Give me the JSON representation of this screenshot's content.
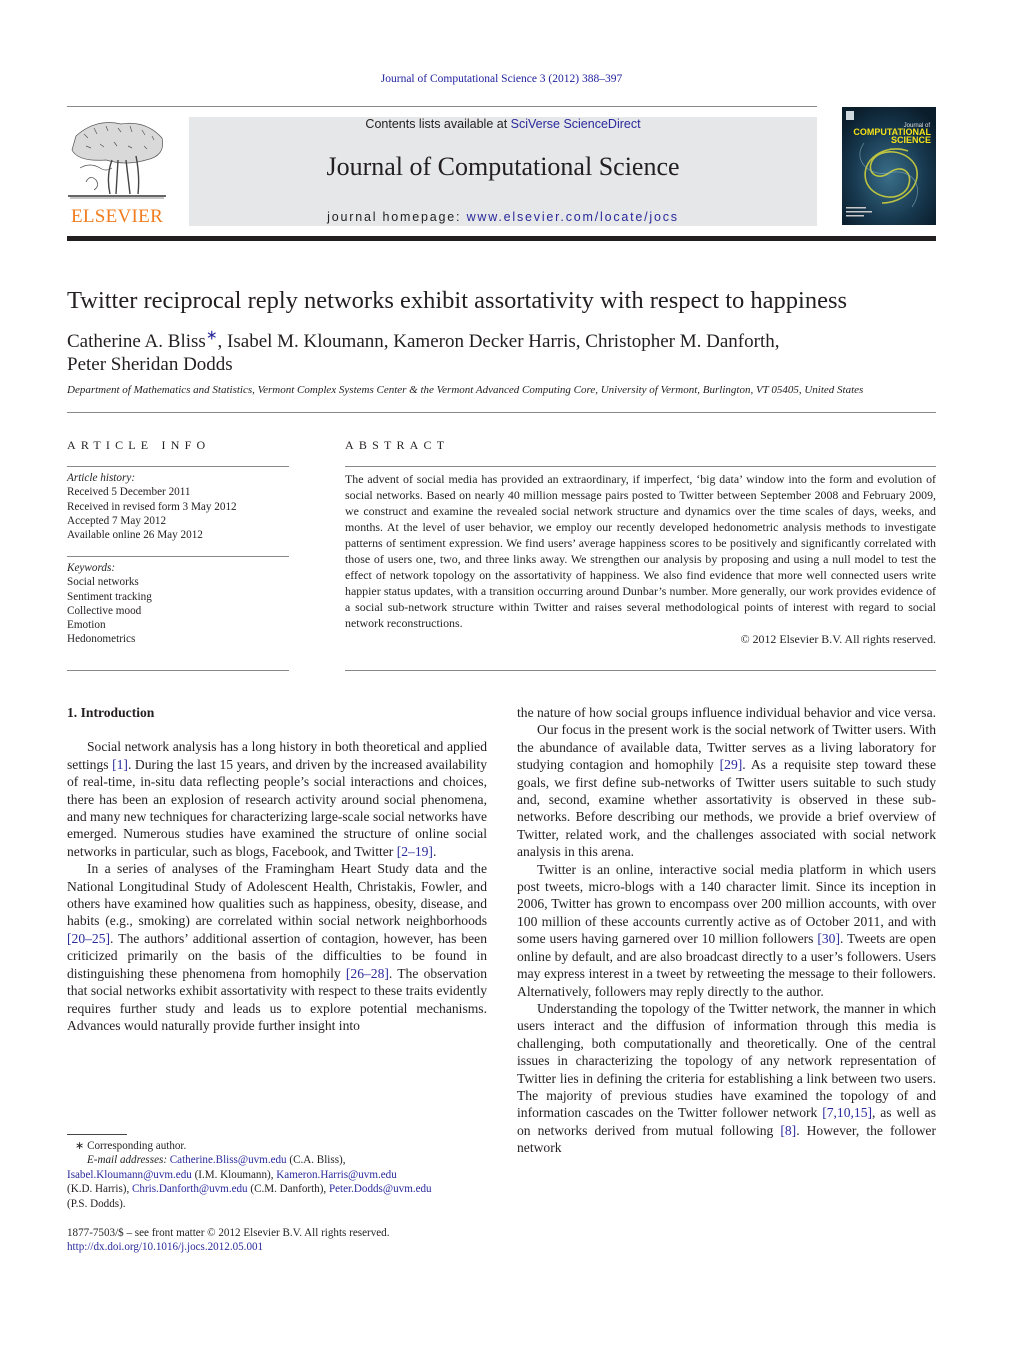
{
  "running_head": "Journal of Computational Science 3 (2012) 388–397",
  "masthead": {
    "contents_prefix": "Contents lists available at ",
    "contents_link": "SciVerse ScienceDirect",
    "journal_title": "Journal of Computational Science",
    "homepage_prefix": "journal homepage: ",
    "homepage_link": "www.elsevier.com/locate/jocs",
    "publisher_logo_text": "ELSEVIER",
    "cover_title_small": "Journal of",
    "cover_title_line1": "COMPUTATIONAL",
    "cover_title_line2": "SCIENCE",
    "colors": {
      "masthead_bg": "#e6e7e8",
      "elsevier_orange": "#f07c1f",
      "link_blue": "#2a2a9c",
      "cover_yellow": "#f4e21a"
    }
  },
  "article": {
    "title": "Twitter reciprocal reply networks exhibit assortativity with respect to happiness",
    "authors_line1_a": "Catherine A. Bliss",
    "author_marker": "∗",
    "authors_line1_b": ", Isabel M. Kloumann, Kameron Decker Harris, Christopher M. Danforth,",
    "authors_line2": "Peter Sheridan Dodds",
    "affiliation": "Department of Mathematics and Statistics, Vermont Complex Systems Center & the Vermont Advanced Computing Core, University of Vermont, Burlington, VT 05405, United States"
  },
  "article_info": {
    "heading": "ARTICLE INFO",
    "history_label": "Article history:",
    "history": [
      "Received 5 December 2011",
      "Received in revised form 3 May 2012",
      "Accepted 7 May 2012",
      "Available online 26 May 2012"
    ],
    "keywords_label": "Keywords:",
    "keywords": [
      "Social networks",
      "Sentiment tracking",
      "Collective mood",
      "Emotion",
      "Hedonometrics"
    ]
  },
  "abstract": {
    "heading": "ABSTRACT",
    "text": "The advent of social media has provided an extraordinary, if imperfect, ‘big data’ window into the form and evolution of social networks. Based on nearly 40 million message pairs posted to Twitter between September 2008 and February 2009, we construct and examine the revealed social network structure and dynamics over the time scales of days, weeks, and months. At the level of user behavior, we employ our recently developed hedonometric analysis methods to investigate patterns of sentiment expression. We find users’ average happiness scores to be positively and significantly correlated with those of users one, two, and three links away. We strengthen our analysis by proposing and using a null model to test the effect of network topology on the assortativity of happiness. We also find evidence that more well connected users write happier status updates, with a transition occurring around Dunbar’s number. More generally, our work provides evidence of a social sub-network structure within Twitter and raises several methodological points of interest with regard to social network reconstructions.",
    "copyright": "© 2012 Elsevier B.V. All rights reserved."
  },
  "body": {
    "section_heading": "1.  Introduction",
    "left": {
      "p1_a": "Social network analysis has a long history in both theoretical and applied settings ",
      "p1_ref1": "[1]",
      "p1_b": ". During the last 15 years, and driven by the increased availability of real-time, in-situ data reflecting people’s social interactions and choices, there has been an explosion of research activity around social phenomena, and many new techniques for characterizing large-scale social networks have emerged. Numerous studies have examined the structure of online social networks in particular, such as blogs, Facebook, and Twitter ",
      "p1_ref2": "[2–19]",
      "p1_c": ".",
      "p2_a": "In a series of analyses of the Framingham Heart Study data and the National Longitudinal Study of Adolescent Health, Christakis, Fowler, and others have examined how qualities such as happiness, obesity, disease, and habits (e.g., smoking) are correlated within social network neighborhoods ",
      "p2_ref1": "[20–25]",
      "p2_b": ". The authors’ additional assertion of contagion, however, has been criticized primarily on the basis of the difficulties to be found in distinguishing these phenomena from homophily ",
      "p2_ref2": "[26–28]",
      "p2_c": ". The observation that social networks exhibit assortativity with respect to these traits evidently requires further study and leads us to explore potential mechanisms. Advances would naturally provide further insight into"
    },
    "right": {
      "p0": "the nature of how social groups influence individual behavior and vice versa.",
      "p1_a": "Our focus in the present work is the social network of Twitter users. With the abundance of available data, Twitter serves as a living laboratory for studying contagion and homophily ",
      "p1_ref": "[29]",
      "p1_b": ". As a requisite step toward these goals, we first define sub-networks of Twitter users suitable to such study and, second, examine whether assortativity is observed in these sub-networks. Before describing our methods, we provide a brief overview of Twitter, related work, and the challenges associated with social network analysis in this arena.",
      "p2_a": "Twitter is an online, interactive social media platform in which users post tweets, micro-blogs with a 140 character limit. Since its inception in 2006, Twitter has grown to encompass over 200 million accounts, with over 100 million of these accounts currently active as of October 2011, and with some users having garnered over 10 million followers ",
      "p2_ref": "[30]",
      "p2_b": ". Tweets are open online by default, and are also broadcast directly to a user’s followers. Users may express interest in a tweet by retweeting the message to their followers. Alternatively, followers may reply directly to the author.",
      "p3_a": "Understanding the topology of the Twitter network, the manner in which users interact and the diffusion of information through this media is challenging, both computationally and theoretically. One of the central issues in characterizing the topology of any network representation of Twitter lies in defining the criteria for establishing a link between two users. The majority of previous studies have examined the topology of and information cascades on the Twitter follower network ",
      "p3_ref1": "[7,10,15]",
      "p3_b": ", as well as on networks derived from mutual following ",
      "p3_ref2": "[8]",
      "p3_c": ". However, the follower network"
    }
  },
  "footnotes": {
    "corresponding": "∗  Corresponding author.",
    "email_label": "E-mail addresses: ",
    "emails": [
      {
        "address": "Catherine.Bliss@uvm.edu",
        "who": " (C.A. Bliss),"
      },
      {
        "address": "Isabel.Kloumann@uvm.edu",
        "who": " (I.M. Kloumann), "
      },
      {
        "address": "Kameron.Harris@uvm.edu",
        "who": " (K.D. Harris), "
      },
      {
        "address": "Chris.Danforth@uvm.edu",
        "who": " (C.M. Danforth), "
      },
      {
        "address": "Peter.Dodds@uvm.edu",
        "who": " (P.S. Dodds)."
      }
    ],
    "front_matter": "1877-7503/$ – see front matter © 2012 Elsevier B.V. All rights reserved.",
    "doi": "http://dx.doi.org/10.1016/j.jocs.2012.05.001"
  }
}
